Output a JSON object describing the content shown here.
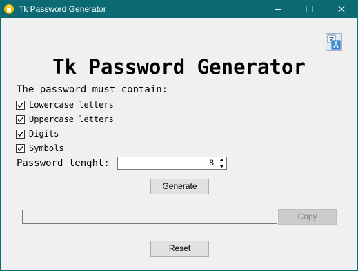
{
  "window": {
    "title": "Tk Password Generator",
    "icons": {
      "app": "lock-icon",
      "minimize": "minimize-icon",
      "maximize": "maximize-icon",
      "close": "close-icon"
    },
    "colors": {
      "titlebar": "#0b6a73",
      "body": "#f0f0f0"
    }
  },
  "toolbar": {
    "translate_icon": "translate-icon"
  },
  "app": {
    "heading": "Tk Password Generator",
    "contain_label": "The password must contain:",
    "options": [
      {
        "label": "Lowercase letters",
        "checked": true
      },
      {
        "label": "Uppercase letters",
        "checked": true
      },
      {
        "label": "Digits",
        "checked": true
      },
      {
        "label": "Symbols",
        "checked": true
      }
    ],
    "length_label": "Password lenght:",
    "length_value": "8",
    "generate_label": "Generate",
    "output_value": "",
    "copy_label": "Copy",
    "copy_disabled": true,
    "reset_label": "Reset"
  }
}
